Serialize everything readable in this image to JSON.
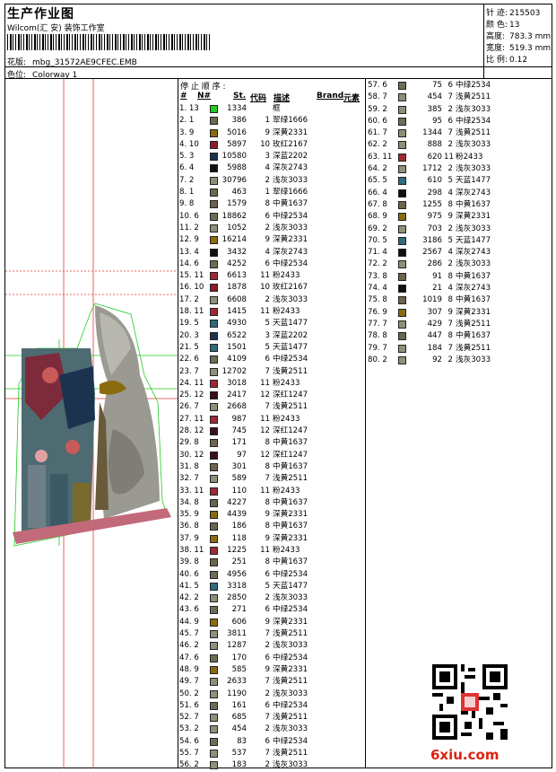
{
  "header": {
    "title": "生产作业图",
    "company": "Wilcom(汇 安) 装饰工作室",
    "design_label": "花版:",
    "design_value": "mbg_31572AE9CFEC.EMB",
    "colorway_label": "色位:",
    "colorway_value": "Colorway 1"
  },
  "info": {
    "stitches_label": "针 迹:",
    "stitches_value": "215503",
    "colors_label": "颜 色:",
    "colors_value": "13",
    "height_label": "高度:",
    "height_value": "783.3 mm",
    "width_label": "宽度:",
    "width_value": "519.3 mm",
    "scale_label": "比 例:",
    "scale_value": "0.12"
  },
  "table": {
    "stop_sequence_label": "停 止 顺 序 :",
    "headers": [
      "#",
      "N#",
      "St.",
      "代码",
      "描述",
      "Brand",
      "元素"
    ]
  },
  "colors": {
    "1": "#22cc22",
    "2": "#6a6a4f",
    "3": "#6b0f24",
    "4": "#111111",
    "5": "#1c3350",
    "6": "#6e6e58",
    "7": "#8f8f7a",
    "8": "#6a6450",
    "9": "#8a6b10",
    "10": "#8a1b2c",
    "11": "#9e2a36",
    "12": "#3a0f1a",
    "13": "#2f6b7a"
  },
  "rows_left": [
    [
      "1.",
      "13",
      "1",
      "1334",
      "",
      "框"
    ],
    [
      "2.",
      "1",
      "2",
      "386",
      "1",
      "翠绿1666"
    ],
    [
      "3.",
      "9",
      "9",
      "5016",
      "9",
      "深黄2331"
    ],
    [
      "4.",
      "10",
      "10",
      "5897",
      "10",
      "玫红2167"
    ],
    [
      "5.",
      "3",
      "5",
      "10580",
      "3",
      "深蓝2202"
    ],
    [
      "6.",
      "4",
      "4",
      "5988",
      "4",
      "深灰2743"
    ],
    [
      "7.",
      "2",
      "7",
      "30796",
      "2",
      "浅灰3033"
    ],
    [
      "8.",
      "1",
      "2",
      "463",
      "1",
      "翠绿1666"
    ],
    [
      "9.",
      "8",
      "8",
      "1579",
      "8",
      "中黄1637"
    ],
    [
      "10.",
      "6",
      "6",
      "18862",
      "6",
      "中绿2534"
    ],
    [
      "11.",
      "2",
      "7",
      "1052",
      "2",
      "浅灰3033"
    ],
    [
      "12.",
      "9",
      "9",
      "16214",
      "9",
      "深黄2331"
    ],
    [
      "13.",
      "4",
      "4",
      "3432",
      "4",
      "深灰2743"
    ],
    [
      "14.",
      "6",
      "6",
      "4252",
      "6",
      "中绿2534"
    ],
    [
      "15.",
      "11",
      "11",
      "6613",
      "11",
      "粉2433"
    ],
    [
      "16.",
      "10",
      "10",
      "1878",
      "10",
      "玫红2167"
    ],
    [
      "17.",
      "2",
      "7",
      "6608",
      "2",
      "浅灰3033"
    ],
    [
      "18.",
      "11",
      "11",
      "1415",
      "11",
      "粉2433"
    ],
    [
      "19.",
      "5",
      "13",
      "4930",
      "5",
      "天蓝1477"
    ],
    [
      "20.",
      "3",
      "5",
      "6522",
      "3",
      "深蓝2202"
    ],
    [
      "21.",
      "5",
      "13",
      "1501",
      "5",
      "天蓝1477"
    ],
    [
      "22.",
      "6",
      "6",
      "4109",
      "6",
      "中绿2534"
    ],
    [
      "23.",
      "7",
      "7",
      "12702",
      "7",
      "浅黄2511"
    ],
    [
      "24.",
      "11",
      "11",
      "3018",
      "11",
      "粉2433"
    ],
    [
      "25.",
      "12",
      "12",
      "2417",
      "12",
      "深红1247"
    ],
    [
      "26.",
      "7",
      "7",
      "2668",
      "7",
      "浅黄2511"
    ],
    [
      "27.",
      "11",
      "11",
      "987",
      "11",
      "粉2433"
    ],
    [
      "28.",
      "12",
      "12",
      "745",
      "12",
      "深红1247"
    ],
    [
      "29.",
      "8",
      "8",
      "171",
      "8",
      "中黄1637"
    ],
    [
      "30.",
      "12",
      "12",
      "97",
      "12",
      "深红1247"
    ],
    [
      "31.",
      "8",
      "8",
      "301",
      "8",
      "中黄1637"
    ],
    [
      "32.",
      "7",
      "7",
      "589",
      "7",
      "浅黄2511"
    ],
    [
      "33.",
      "11",
      "11",
      "110",
      "11",
      "粉2433"
    ],
    [
      "34.",
      "8",
      "8",
      "4227",
      "8",
      "中黄1637"
    ],
    [
      "35.",
      "9",
      "9",
      "4439",
      "9",
      "深黄2331"
    ],
    [
      "36.",
      "8",
      "8",
      "186",
      "8",
      "中黄1637"
    ],
    [
      "37.",
      "9",
      "9",
      "118",
      "9",
      "深黄2331"
    ],
    [
      "38.",
      "11",
      "11",
      "1225",
      "11",
      "粉2433"
    ],
    [
      "39.",
      "8",
      "8",
      "251",
      "8",
      "中黄1637"
    ],
    [
      "40.",
      "6",
      "6",
      "4956",
      "6",
      "中绿2534"
    ],
    [
      "41.",
      "5",
      "13",
      "3318",
      "5",
      "天蓝1477"
    ],
    [
      "42.",
      "2",
      "7",
      "2850",
      "2",
      "浅灰3033"
    ],
    [
      "43.",
      "6",
      "6",
      "271",
      "6",
      "中绿2534"
    ],
    [
      "44.",
      "9",
      "9",
      "606",
      "9",
      "深黄2331"
    ],
    [
      "45.",
      "7",
      "7",
      "3811",
      "7",
      "浅黄2511"
    ],
    [
      "46.",
      "2",
      "7",
      "1287",
      "2",
      "浅灰3033"
    ],
    [
      "47.",
      "6",
      "6",
      "170",
      "6",
      "中绿2534"
    ],
    [
      "48.",
      "9",
      "9",
      "585",
      "9",
      "深黄2331"
    ],
    [
      "49.",
      "7",
      "7",
      "2633",
      "7",
      "浅黄2511"
    ],
    [
      "50.",
      "2",
      "7",
      "1190",
      "2",
      "浅灰3033"
    ],
    [
      "51.",
      "6",
      "6",
      "161",
      "6",
      "中绿2534"
    ],
    [
      "52.",
      "7",
      "7",
      "685",
      "7",
      "浅黄2511"
    ],
    [
      "53.",
      "2",
      "7",
      "454",
      "2",
      "浅灰3033"
    ],
    [
      "54.",
      "6",
      "6",
      "83",
      "6",
      "中绿2534"
    ],
    [
      "55.",
      "7",
      "7",
      "537",
      "7",
      "浅黄2511"
    ],
    [
      "56.",
      "2",
      "7",
      "183",
      "2",
      "浅灰3033"
    ]
  ],
  "rows_right": [
    [
      "57.",
      "6",
      "6",
      "75",
      "6",
      "中绿2534"
    ],
    [
      "58.",
      "7",
      "7",
      "454",
      "7",
      "浅黄2511"
    ],
    [
      "59.",
      "2",
      "7",
      "385",
      "2",
      "浅灰3033"
    ],
    [
      "60.",
      "6",
      "6",
      "95",
      "6",
      "中绿2534"
    ],
    [
      "61.",
      "7",
      "7",
      "1344",
      "7",
      "浅黄2511"
    ],
    [
      "62.",
      "2",
      "7",
      "888",
      "2",
      "浅灰3033"
    ],
    [
      "63.",
      "11",
      "11",
      "620",
      "11",
      "粉2433"
    ],
    [
      "64.",
      "2",
      "7",
      "1712",
      "2",
      "浅灰3033"
    ],
    [
      "65.",
      "5",
      "13",
      "610",
      "5",
      "天蓝1477"
    ],
    [
      "66.",
      "4",
      "4",
      "298",
      "4",
      "深灰2743"
    ],
    [
      "67.",
      "8",
      "8",
      "1255",
      "8",
      "中黄1637"
    ],
    [
      "68.",
      "9",
      "9",
      "975",
      "9",
      "深黄2331"
    ],
    [
      "69.",
      "2",
      "7",
      "703",
      "2",
      "浅灰3033"
    ],
    [
      "70.",
      "5",
      "13",
      "3186",
      "5",
      "天蓝1477"
    ],
    [
      "71.",
      "4",
      "4",
      "2567",
      "4",
      "深灰2743"
    ],
    [
      "72.",
      "2",
      "7",
      "286",
      "2",
      "浅灰3033"
    ],
    [
      "73.",
      "8",
      "8",
      "91",
      "8",
      "中黄1637"
    ],
    [
      "74.",
      "4",
      "4",
      "21",
      "4",
      "深灰2743"
    ],
    [
      "75.",
      "8",
      "8",
      "1019",
      "8",
      "中黄1637"
    ],
    [
      "76.",
      "9",
      "9",
      "307",
      "9",
      "深黄2331"
    ],
    [
      "77.",
      "7",
      "7",
      "429",
      "7",
      "浅黄2511"
    ],
    [
      "78.",
      "8",
      "8",
      "447",
      "8",
      "中黄1637"
    ],
    [
      "79.",
      "7",
      "7",
      "184",
      "7",
      "浅黄2511"
    ],
    [
      "80.",
      "2",
      "7",
      "92",
      "2",
      "浅灰3033"
    ]
  ],
  "watermark": "6xiu.com"
}
